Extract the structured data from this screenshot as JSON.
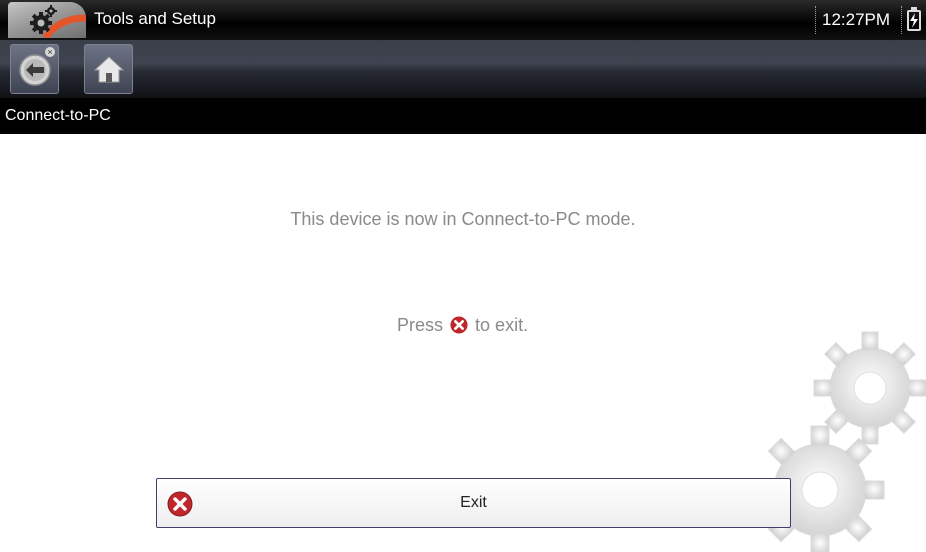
{
  "titlebar": {
    "title": "Tools and Setup",
    "clock": "12:27PM",
    "app_icon": "gear-icon",
    "battery_icon": "battery-charging-icon"
  },
  "toolbar": {
    "back_icon": "back-arrow-icon",
    "home_icon": "home-icon"
  },
  "breadcrumb": {
    "label": "Connect-to-PC"
  },
  "main": {
    "message": "This device is now in Connect-to-PC mode.",
    "press_prefix": "Press",
    "press_suffix": "to exit."
  },
  "exit_button": {
    "label": "Exit",
    "icon": "close-circle-icon"
  },
  "colors": {
    "exit_red": "#c0272d",
    "message_gray": "#8a8a8a",
    "header_black": "#000000"
  }
}
